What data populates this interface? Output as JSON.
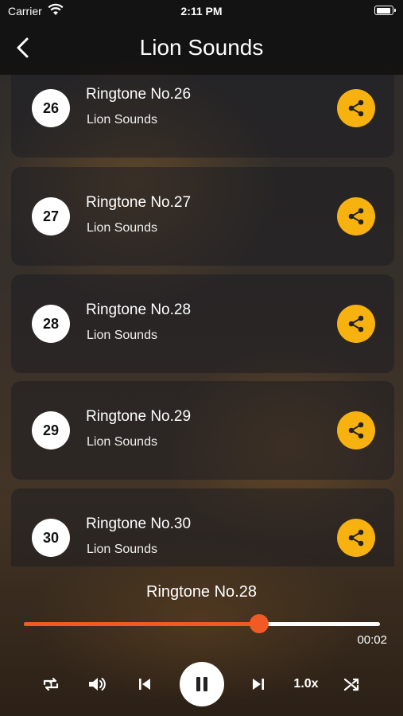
{
  "status_bar": {
    "carrier": "Carrier",
    "time": "2:11 PM"
  },
  "nav": {
    "title": "Lion Sounds",
    "back_icon": "chevron-left-icon"
  },
  "list": {
    "items": [
      {
        "number": "26",
        "title": "Ringtone No.26",
        "subtitle": "Lion Sounds"
      },
      {
        "number": "27",
        "title": "Ringtone No.27",
        "subtitle": "Lion Sounds"
      },
      {
        "number": "28",
        "title": "Ringtone No.28",
        "subtitle": "Lion Sounds"
      },
      {
        "number": "29",
        "title": "Ringtone No.29",
        "subtitle": "Lion Sounds"
      },
      {
        "number": "30",
        "title": "Ringtone No.30",
        "subtitle": "Lion Sounds"
      }
    ],
    "share_icon": "share-icon"
  },
  "player": {
    "now_playing": "Ringtone No.28",
    "progress_fraction": 0.66,
    "elapsed": "00:02",
    "speed": "1.0x",
    "icons": [
      "repeat-one-icon",
      "volume-icon",
      "previous-icon",
      "pause-icon",
      "next-icon",
      "shuffle-icon"
    ]
  },
  "colors": {
    "accent": "#f7b20f",
    "progress": "#f15a24"
  }
}
